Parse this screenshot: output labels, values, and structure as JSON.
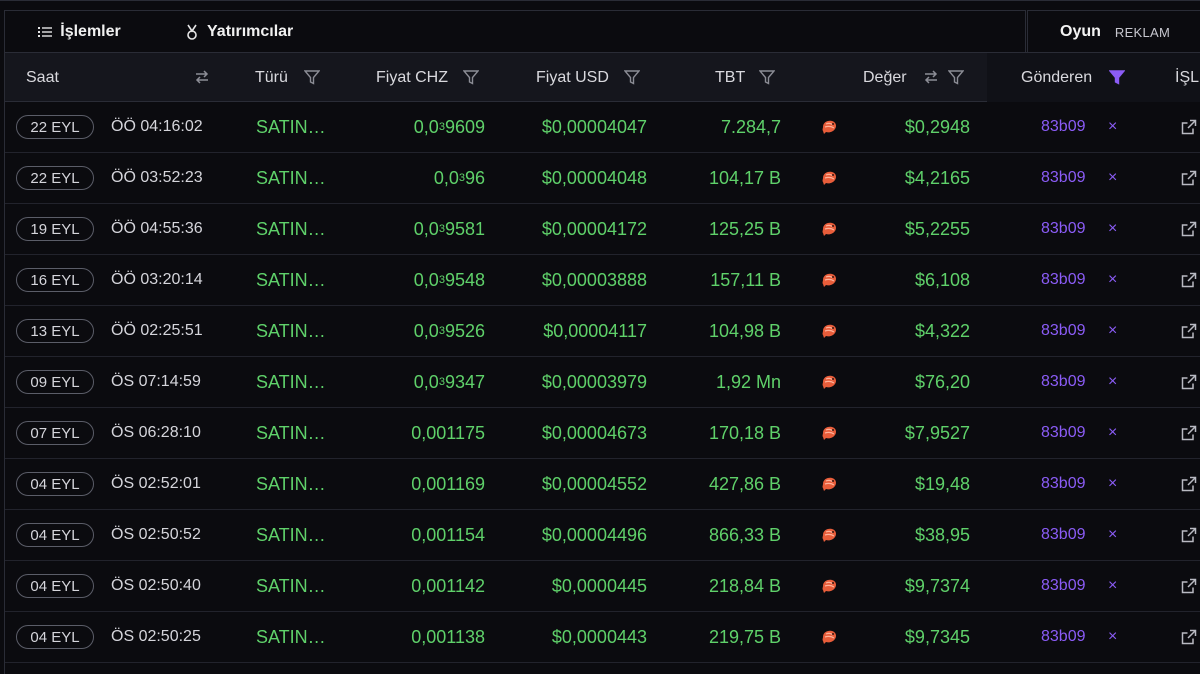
{
  "tabs": [
    {
      "label": "İşlemler",
      "icon": "list-icon",
      "active": true
    },
    {
      "label": "Yatırımcılar",
      "icon": "medal-icon",
      "active": false
    }
  ],
  "right_panel": {
    "label": "Oyun",
    "ad": "REKLAM"
  },
  "columns": {
    "saat": "Saat",
    "turu": "Türü",
    "fiyat_chz": "Fiyat CHZ",
    "fiyat_usd": "Fiyat USD",
    "tbt": "TBT",
    "deger": "Değer",
    "gonderen": "Gönderen",
    "islem": "İŞL"
  },
  "colors": {
    "green": "#5fd16a",
    "purple": "#8b5cf6",
    "background": "#0b0b0f",
    "header_bg": "#15161d"
  },
  "rows": [
    {
      "date": "22 EYL",
      "time": "ÖÖ 04:16:02",
      "type": "SATIN…",
      "chz_main": "0,0",
      "chz_sub": "3",
      "chz_rest": "9609",
      "usd": "$0,00004047",
      "tbt": "7.284,7",
      "deger": "$0,2948",
      "sender": "83b09",
      "x": "×"
    },
    {
      "date": "22 EYL",
      "time": "ÖÖ 03:52:23",
      "type": "SATIN…",
      "chz_main": "0,0",
      "chz_sub": "3",
      "chz_rest": "96",
      "usd": "$0,00004048",
      "tbt": "104,17 B",
      "deger": "$4,2165",
      "sender": "83b09",
      "x": "×"
    },
    {
      "date": "19 EYL",
      "time": "ÖÖ 04:55:36",
      "type": "SATIN…",
      "chz_main": "0,0",
      "chz_sub": "3",
      "chz_rest": "9581",
      "usd": "$0,00004172",
      "tbt": "125,25 B",
      "deger": "$5,2255",
      "sender": "83b09",
      "x": "×"
    },
    {
      "date": "16 EYL",
      "time": "ÖÖ 03:20:14",
      "type": "SATIN…",
      "chz_main": "0,0",
      "chz_sub": "3",
      "chz_rest": "9548",
      "usd": "$0,00003888",
      "tbt": "157,11 B",
      "deger": "$6,108",
      "sender": "83b09",
      "x": "×"
    },
    {
      "date": "13 EYL",
      "time": "ÖÖ 02:25:51",
      "type": "SATIN…",
      "chz_main": "0,0",
      "chz_sub": "3",
      "chz_rest": "9526",
      "usd": "$0,00004117",
      "tbt": "104,98 B",
      "deger": "$4,322",
      "sender": "83b09",
      "x": "×"
    },
    {
      "date": "09 EYL",
      "time": "ÖS 07:14:59",
      "type": "SATIN…",
      "chz_main": "0,0",
      "chz_sub": "3",
      "chz_rest": "9347",
      "usd": "$0,00003979",
      "tbt": "1,92 Mn",
      "deger": "$76,20",
      "sender": "83b09",
      "x": "×"
    },
    {
      "date": "07 EYL",
      "time": "ÖS 06:28:10",
      "type": "SATIN…",
      "chz_main": "0,001175",
      "chz_sub": "",
      "chz_rest": "",
      "usd": "$0,00004673",
      "tbt": "170,18 B",
      "deger": "$7,9527",
      "sender": "83b09",
      "x": "×"
    },
    {
      "date": "04 EYL",
      "time": "ÖS 02:52:01",
      "type": "SATIN…",
      "chz_main": "0,001169",
      "chz_sub": "",
      "chz_rest": "",
      "usd": "$0,00004552",
      "tbt": "427,86 B",
      "deger": "$19,48",
      "sender": "83b09",
      "x": "×"
    },
    {
      "date": "04 EYL",
      "time": "ÖS 02:50:52",
      "type": "SATIN…",
      "chz_main": "0,001154",
      "chz_sub": "",
      "chz_rest": "",
      "usd": "$0,00004496",
      "tbt": "866,33 B",
      "deger": "$38,95",
      "sender": "83b09",
      "x": "×"
    },
    {
      "date": "04 EYL",
      "time": "ÖS 02:50:40",
      "type": "SATIN…",
      "chz_main": "0,001142",
      "chz_sub": "",
      "chz_rest": "",
      "usd": "$0,0000445",
      "tbt": "218,84 B",
      "deger": "$9,7374",
      "sender": "83b09",
      "x": "×"
    },
    {
      "date": "04 EYL",
      "time": "ÖS 02:50:25",
      "type": "SATIN…",
      "chz_main": "0,001138",
      "chz_sub": "",
      "chz_rest": "",
      "usd": "$0,0000443",
      "tbt": "219,75 B",
      "deger": "$9,7345",
      "sender": "83b09",
      "x": "×"
    }
  ]
}
